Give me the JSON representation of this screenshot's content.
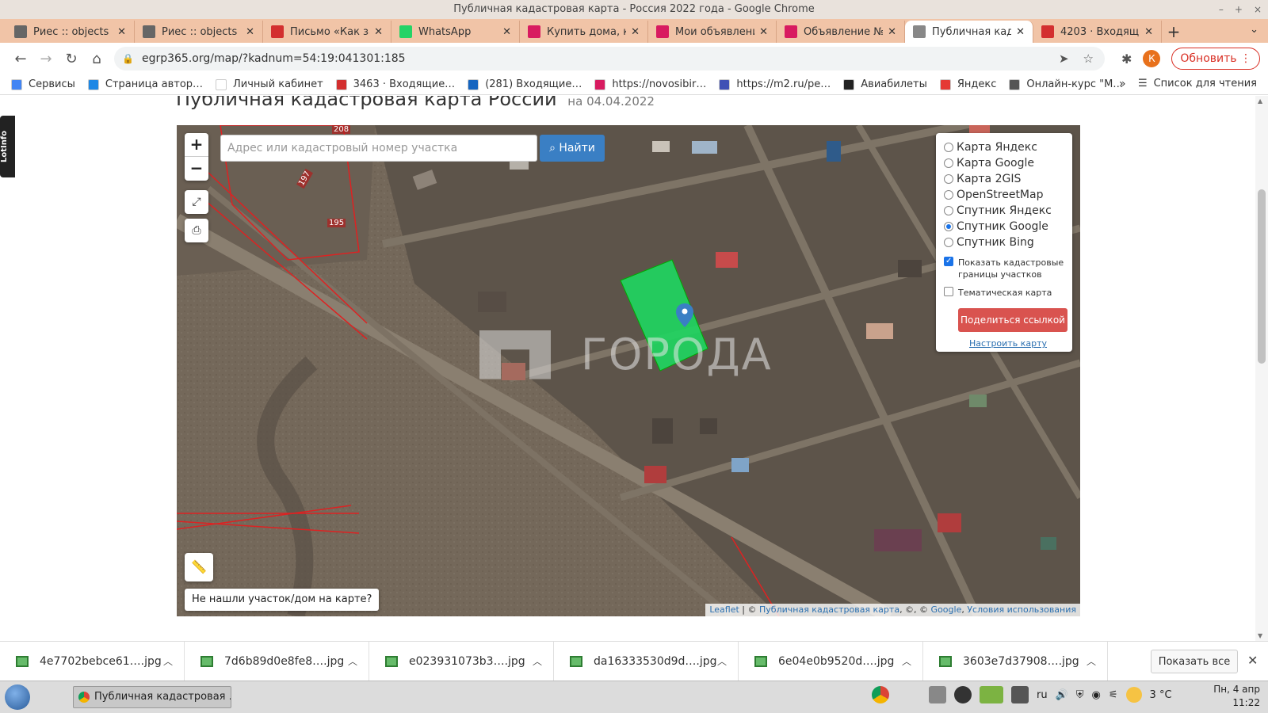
{
  "window": {
    "title": "Публичная кадастровая карта - Россия 2022 года - Google Chrome",
    "controls": [
      "–",
      "+",
      "×"
    ]
  },
  "tabs": [
    {
      "label": "Риес :: objects",
      "icon": "grid-favicon",
      "color": "#666"
    },
    {
      "label": "Риес :: objects",
      "icon": "grid-favicon",
      "color": "#666"
    },
    {
      "label": "Письмо «Как за",
      "icon": "mail-favicon",
      "color": "#d32f2f"
    },
    {
      "label": "WhatsApp",
      "icon": "whatsapp-favicon",
      "color": "#25d366"
    },
    {
      "label": "Купить дома, ко",
      "icon": "m-favicon",
      "color": "#d81b60"
    },
    {
      "label": "Мои объявлени",
      "icon": "m-favicon",
      "color": "#d81b60"
    },
    {
      "label": "Объявление №",
      "icon": "m-favicon",
      "color": "#d81b60"
    },
    {
      "label": "Публичная када",
      "icon": "page-favicon",
      "color": "#888",
      "active": true
    },
    {
      "label": "4203 · Входящие",
      "icon": "mail-favicon",
      "color": "#d32f2f"
    }
  ],
  "toolbar": {
    "url": "egrp365.org/map/?kadnum=54:19:041301:185",
    "profile_initial": "К",
    "update_label": "Обновить"
  },
  "bookmarks": {
    "items": [
      {
        "label": "Сервисы",
        "color": "#4285f4"
      },
      {
        "label": "Страница автор…",
        "color": "#1e88e5"
      },
      {
        "label": "Личный кабинет",
        "color": "#ffffff"
      },
      {
        "label": "3463 · Входящие…",
        "color": "#d32f2f"
      },
      {
        "label": "(281) Входящие…",
        "color": "#1565c0"
      },
      {
        "label": "https://novosibir…",
        "color": "#d81b60"
      },
      {
        "label": "https://m2.ru/pe…",
        "color": "#3f51b5"
      },
      {
        "label": "Авиабилеты",
        "color": "#222222"
      },
      {
        "label": "Яндекс",
        "color": "#e53935"
      },
      {
        "label": "Онлайн-курс \"М…",
        "color": "#555555"
      }
    ],
    "more": "»",
    "reading_list": "Список для чтения"
  },
  "page": {
    "title": "Публичная кадастровая карта России",
    "date": "на 04.04.2022",
    "lotinfo": "LotInfo"
  },
  "map": {
    "search_placeholder": "Адрес или кадастровый номер участка",
    "find_label": "Найти",
    "zoom_in": "+",
    "zoom_out": "−",
    "plot_labels": [
      "208",
      "197",
      "195"
    ],
    "watermark": "ГОРОДА",
    "layers": [
      {
        "label": "Карта Яндекс",
        "selected": false
      },
      {
        "label": "Карта Google",
        "selected": false
      },
      {
        "label": "Карта 2GIS",
        "selected": false
      },
      {
        "label": "OpenStreetMap",
        "selected": false
      },
      {
        "label": "Спутник Яндекс",
        "selected": false
      },
      {
        "label": "Спутник Google",
        "selected": true
      },
      {
        "label": "Спутник Bing",
        "selected": false
      }
    ],
    "show_boundaries": {
      "label": "Показать кадастровые границы участков",
      "checked": true
    },
    "thematic": {
      "label": "Тематическая карта",
      "checked": false
    },
    "share_label": "Поделиться ссылкой",
    "configure_label": "Настроить карту",
    "not_found_label": "Не нашли участок/дом на карте?",
    "attribution": {
      "leaflet": "Leaflet",
      "sep1": " | © ",
      "pkk": "Публичная кадастровая карта",
      "sep2": ", ©, © ",
      "google": "Google",
      "sep3": ", ",
      "terms": "Условия использования"
    },
    "highlight_color": "#1ed760"
  },
  "downloads": {
    "files": [
      "4e7702bebce61….jpg",
      "7d6b89d0e8fe8….jpg",
      "e023931073b3….jpg",
      "da16333530d9d….jpg",
      "6e04e0b9520d….jpg",
      "3603e7d37908….jpg"
    ],
    "show_all": "Показать все"
  },
  "taskbar": {
    "window_label": "Публичная кадастровая …",
    "lang": "ru",
    "temp": "3 °C",
    "date": "Пн, 4 апр",
    "time": "11:22"
  }
}
